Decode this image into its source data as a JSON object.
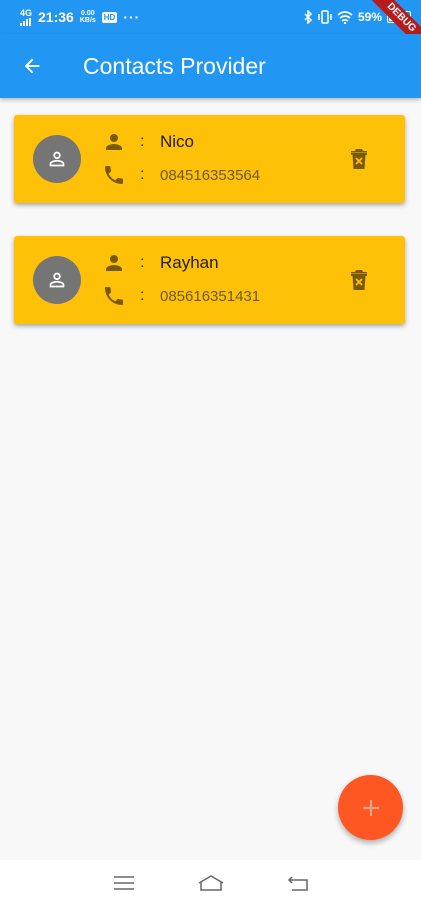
{
  "status_bar": {
    "network": "4G",
    "time": "21:36",
    "speed_value": "0.00",
    "speed_unit": "KB/s",
    "hd": "HD",
    "dots": "···",
    "battery": "59%",
    "debug": "DEBUG"
  },
  "app_bar": {
    "title": "Contacts Provider"
  },
  "contacts": [
    {
      "name": "Nico",
      "phone": "084516353564"
    },
    {
      "name": "Rayhan",
      "phone": "085616351431"
    }
  ],
  "separator": ":",
  "colors": {
    "primary": "#2196f3",
    "card": "#ffc107",
    "fab": "#ff5722",
    "avatar": "#757575"
  }
}
